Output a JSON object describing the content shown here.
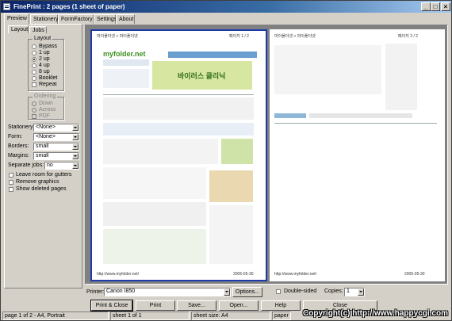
{
  "window": {
    "title": "FinePrint : 2 pages (1 sheet of paper)"
  },
  "tabs": [
    "Preview",
    "Stationery",
    "FormFactory",
    "Settings",
    "About"
  ],
  "subtabs": [
    "Layout",
    "Jobs"
  ],
  "layout": {
    "group_label": "Layout",
    "options": [
      "Bypass",
      "1 up",
      "2 up",
      "4 up",
      "8 up",
      "Booklet",
      "Repeat"
    ],
    "selected": "2 up",
    "ordering": {
      "label": "Ordering",
      "options": [
        "Down",
        "Across",
        "PDF"
      ]
    }
  },
  "fields": {
    "stationery": {
      "label": "Stationery:",
      "value": "<None>"
    },
    "form": {
      "label": "Form:",
      "value": "<None>"
    },
    "borders": {
      "label": "Borders:",
      "value": "small"
    },
    "margins": {
      "label": "Margins:",
      "value": "small"
    },
    "separate_jobs": {
      "label": "Separate jobs:",
      "value": "no"
    }
  },
  "checkboxes": [
    "Leave room for gutters",
    "Remove graphics",
    "Show deleted pages"
  ],
  "page_content": {
    "left": {
      "header_left": "마이폴더넷 > 마이폴더넷",
      "header_right": "페이지 1 / 2",
      "logo": "myfolder.net",
      "banner_text": "바이러스 클리닉",
      "footer_left": "http://www.myfolder.net/",
      "footer_right": "2005-05-30"
    },
    "right": {
      "header_left": "마이폴더넷 > 마이폴더넷",
      "header_right": "페이지 2 / 2",
      "footer_left": "http://www.myfolder.net/",
      "footer_right": "2005-05-30"
    }
  },
  "printer": {
    "label": "Printer:",
    "value": "Canon I850",
    "options_button": "Options..."
  },
  "double_sided": {
    "label": "Double-sided"
  },
  "copies": {
    "label": "Copies:",
    "value": "1"
  },
  "buttons": [
    "Print & Close",
    "Print",
    "Save...",
    "Open...",
    "Help",
    "Close"
  ],
  "status": [
    "page 1 of 2 - A4, Portrait",
    "sheet 1 of 1",
    "sheet size: A4",
    "paper s"
  ],
  "copyright": "Copyright(c) http://www.happycgi.com",
  "colors": {
    "title_bar": "#0a246a",
    "selection": "#1c3aa9",
    "logo_green": "#3a8f1e"
  }
}
